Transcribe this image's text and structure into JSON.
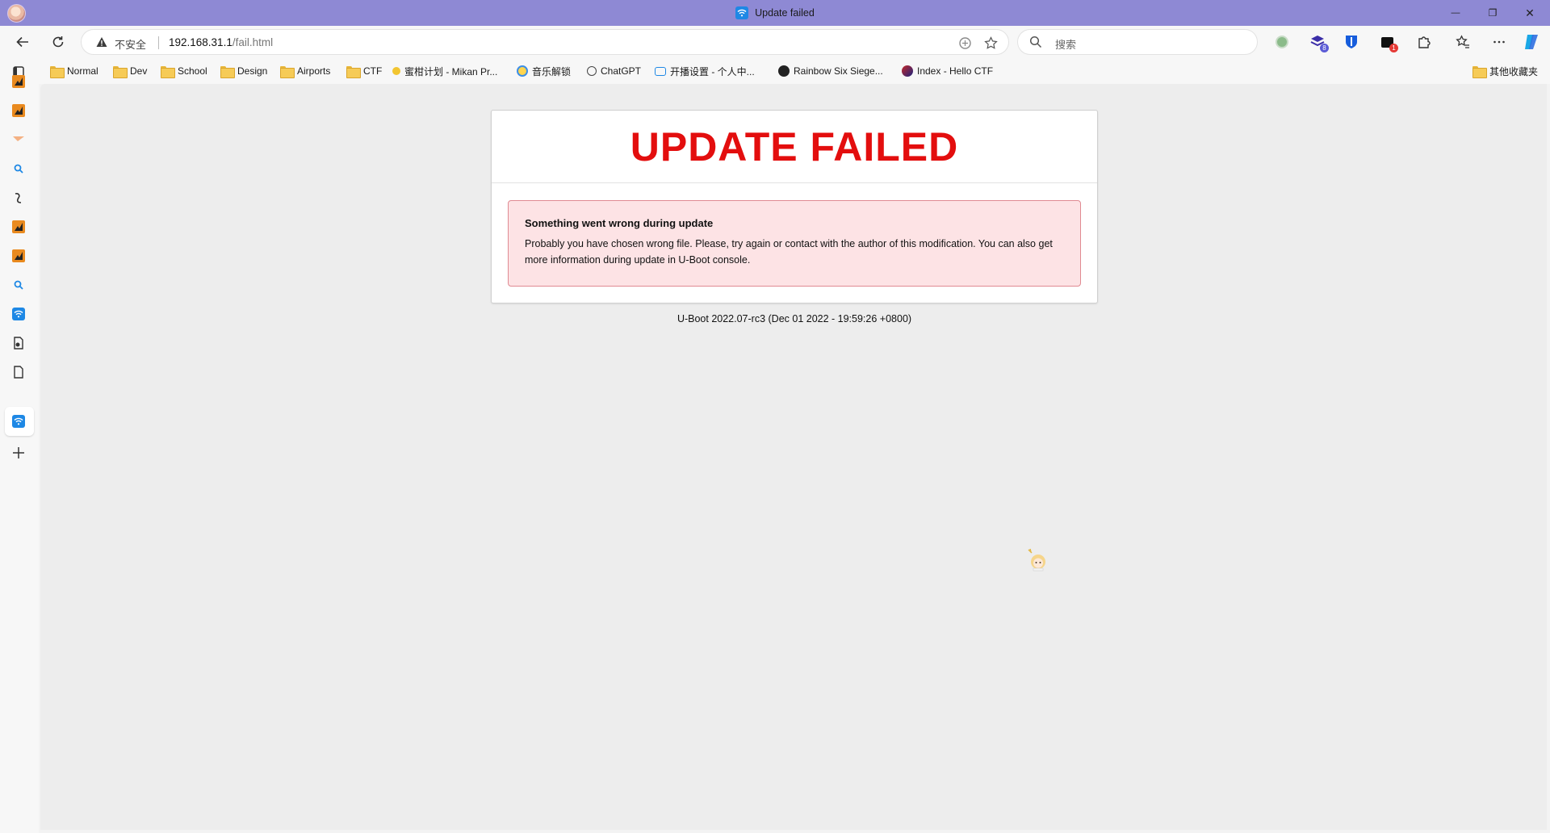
{
  "window": {
    "tab_title": "Update failed",
    "controls": {
      "minimize": "—",
      "restore": "❐",
      "close": "✕"
    }
  },
  "toolbar": {
    "security_label": "不安全",
    "url_host": "192.168.31.1",
    "url_path": "/fail.html",
    "search_placeholder": "搜索",
    "extension_badges": {
      "puzzle_ext": "8",
      "dark_ext": "1"
    }
  },
  "bookmarks": {
    "items": [
      {
        "label": "Normal",
        "icon": "folder-icon"
      },
      {
        "label": "Dev",
        "icon": "folder-icon"
      },
      {
        "label": "School",
        "icon": "folder-icon"
      },
      {
        "label": "Design",
        "icon": "folder-icon"
      },
      {
        "label": "Airports",
        "icon": "folder-icon"
      },
      {
        "label": "CTF",
        "icon": "folder-icon"
      },
      {
        "label": "蜜柑计划 - Mikan Pr...",
        "icon": "mikan-icon"
      },
      {
        "label": "音乐解锁",
        "icon": "music-icon"
      },
      {
        "label": "ChatGPT",
        "icon": "chatgpt-icon"
      },
      {
        "label": "开播设置 - 个人中...",
        "icon": "bilibili-icon"
      },
      {
        "label": "Rainbow Six Siege...",
        "icon": "r6-icon"
      },
      {
        "label": "Index - Hello CTF",
        "icon": "helloctf-icon"
      }
    ],
    "other_label": "其他收藏夹"
  },
  "page": {
    "heading": "UPDATE FAILED",
    "alert_title": "Something went wrong during update",
    "alert_body": "Probably you have chosen wrong file. Please, try again or contact with the author of this modification. You can also get more information during update in U-Boot console.",
    "version": "U-Boot 2022.07-rc3 (Dec 01 2022 - 19:59:26 +0800)"
  },
  "colors": {
    "titlebar": "#8e89d4",
    "heading_red": "#e30e0e",
    "alert_bg": "#fde3e5",
    "alert_border": "#e08a92"
  }
}
